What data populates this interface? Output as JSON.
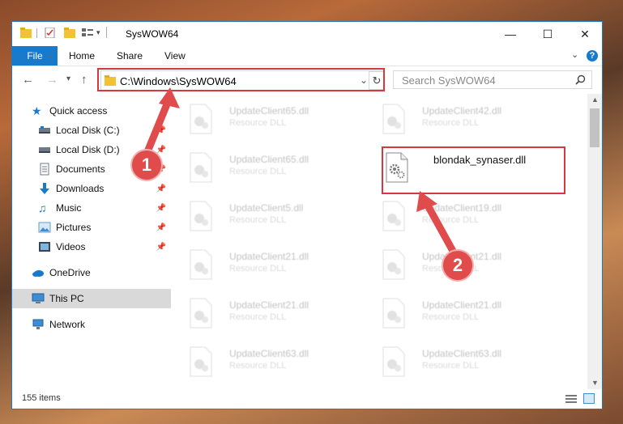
{
  "window": {
    "title": "SysWOW64",
    "controls": {
      "minimize": "—",
      "maximize": "☐",
      "close": "✕"
    }
  },
  "ribbon": {
    "file": "File",
    "tabs": [
      "Home",
      "Share",
      "View"
    ],
    "help": "?"
  },
  "address": {
    "path": "C:\\Windows\\SysWOW64",
    "search_placeholder": "Search SysWOW64"
  },
  "sidebar": {
    "quick_access": "Quick access",
    "items": [
      {
        "label": "Local Disk (C:)",
        "icon": "drive-icon",
        "pinned": true
      },
      {
        "label": "Local Disk (D:)",
        "icon": "drive-icon",
        "pinned": true
      },
      {
        "label": "Documents",
        "icon": "documents-icon",
        "pinned": true
      },
      {
        "label": "Downloads",
        "icon": "downloads-icon",
        "pinned": true
      },
      {
        "label": "Music",
        "icon": "music-icon",
        "pinned": true
      },
      {
        "label": "Pictures",
        "icon": "pictures-icon",
        "pinned": true
      },
      {
        "label": "Videos",
        "icon": "videos-icon",
        "pinned": true
      }
    ],
    "onedrive": "OneDrive",
    "this_pc": "This PC",
    "network": "Network"
  },
  "files": [
    {
      "name": "UpdateClient65.dll",
      "type": "Resource DLL"
    },
    {
      "name": "UpdateClient42.dll",
      "type": "Resource DLL"
    },
    {
      "name": "UpdateClient65.dll",
      "type": "Resource DLL"
    },
    {
      "name": "blondak_synaser.dll",
      "type": ""
    },
    {
      "name": "UpdateClient5.dll",
      "type": "Resource DLL"
    },
    {
      "name": "UpdateClient19.dll",
      "type": "Resource DLL"
    },
    {
      "name": "UpdateClient21.dll",
      "type": "Resource DLL"
    },
    {
      "name": "UpdateClient21.dll",
      "type": "Resource DLL"
    },
    {
      "name": "UpdateClient21.dll",
      "type": "Resource DLL"
    },
    {
      "name": "UpdateClient21.dll",
      "type": "Resource DLL"
    },
    {
      "name": "UpdateClient63.dll",
      "type": "Resource DLL"
    },
    {
      "name": "UpdateClient63.dll",
      "type": "Resource DLL"
    }
  ],
  "status": {
    "items": "155 items"
  },
  "annotations": {
    "step1": "1",
    "step2": "2"
  },
  "colors": {
    "accent": "#1979ca",
    "annotation": "#d7373d"
  }
}
